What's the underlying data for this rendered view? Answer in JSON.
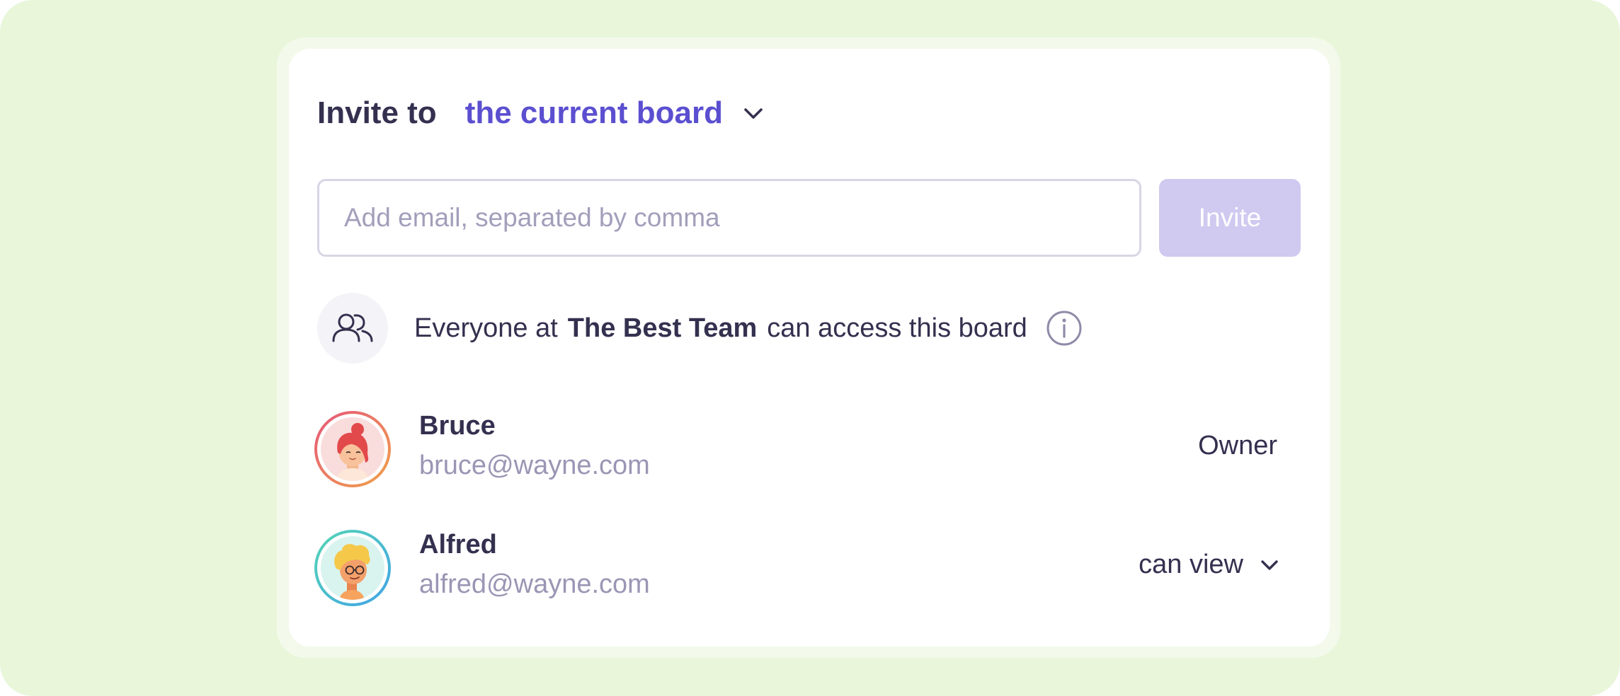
{
  "header": {
    "prefix": "Invite to",
    "board_selector": "the current board"
  },
  "invite_form": {
    "email_placeholder": "Add email, separated by comma",
    "email_value": "",
    "invite_label": "Invite"
  },
  "team_access": {
    "text_before": "Everyone at",
    "team_name": "The Best Team",
    "text_after": "can access this board",
    "icon": "users-icon",
    "info_icon": "info-icon"
  },
  "members": [
    {
      "name": "Bruce",
      "email": "bruce@wayne.com",
      "role": "Owner",
      "role_editable": false,
      "avatar_icon": "avatar-red-hair"
    },
    {
      "name": "Alfred",
      "email": "alfred@wayne.com",
      "role": "can view",
      "role_editable": true,
      "avatar_icon": "avatar-blonde-glasses"
    }
  ],
  "colors": {
    "page_background": "#e9f6da",
    "accent": "#5b4fd0",
    "invite_button_disabled": "#d0c9f0",
    "text_primary": "#34304f",
    "text_secondary": "#9a96b4"
  }
}
